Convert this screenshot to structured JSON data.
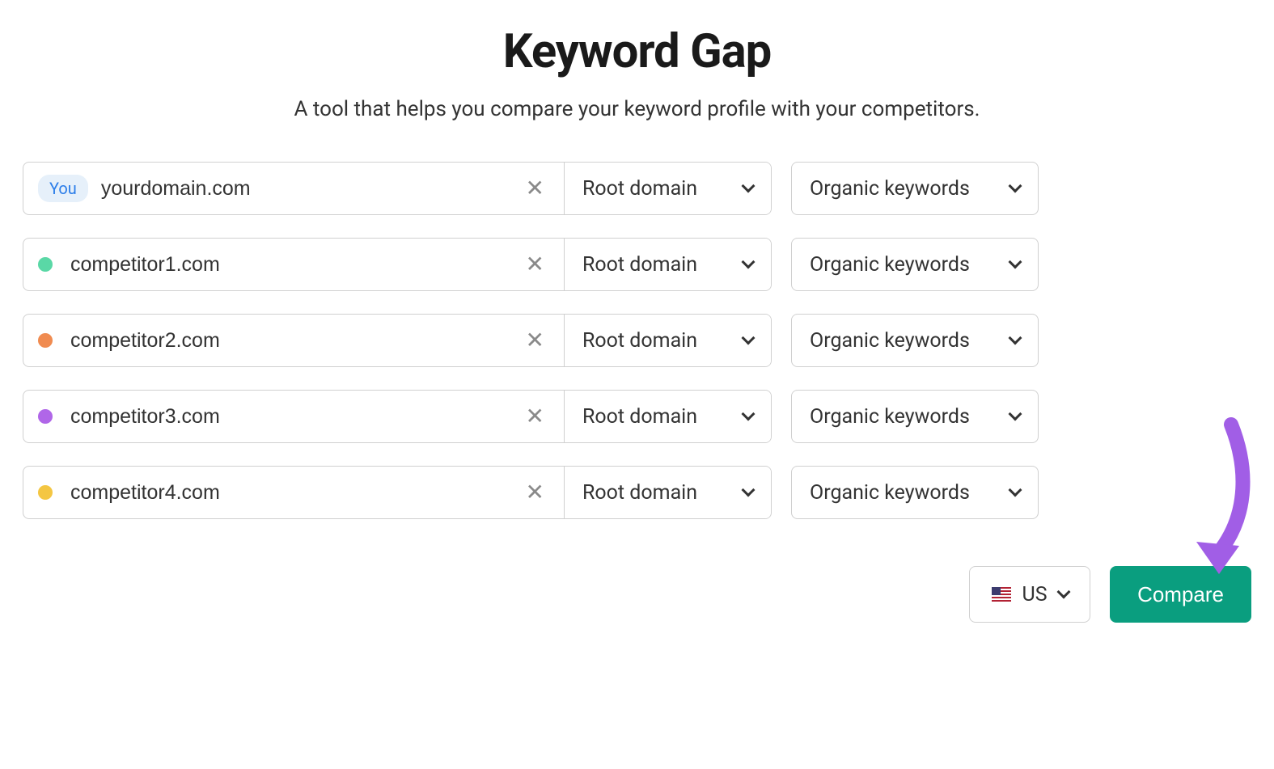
{
  "header": {
    "title": "Keyword Gap",
    "subtitle": "A tool that helps you compare your keyword profile with your competitors."
  },
  "rows": [
    {
      "badge": "You",
      "dot": null,
      "domain": "yourdomain.com",
      "scope": "Root domain",
      "keywords": "Organic keywords"
    },
    {
      "badge": null,
      "dot": "#5ad8a6",
      "domain": "competitor1.com",
      "scope": "Root domain",
      "keywords": "Organic keywords"
    },
    {
      "badge": null,
      "dot": "#f08b50",
      "domain": "competitor2.com",
      "scope": "Root domain",
      "keywords": "Organic keywords"
    },
    {
      "badge": null,
      "dot": "#b066e8",
      "domain": "competitor3.com",
      "scope": "Root domain",
      "keywords": "Organic keywords"
    },
    {
      "badge": null,
      "dot": "#f4c642",
      "domain": "competitor4.com",
      "scope": "Root domain",
      "keywords": "Organic keywords"
    }
  ],
  "footer": {
    "country": "US",
    "compare_label": "Compare"
  },
  "colors": {
    "primary_button": "#0a9e7f",
    "annotation_arrow": "#a15ee6"
  }
}
